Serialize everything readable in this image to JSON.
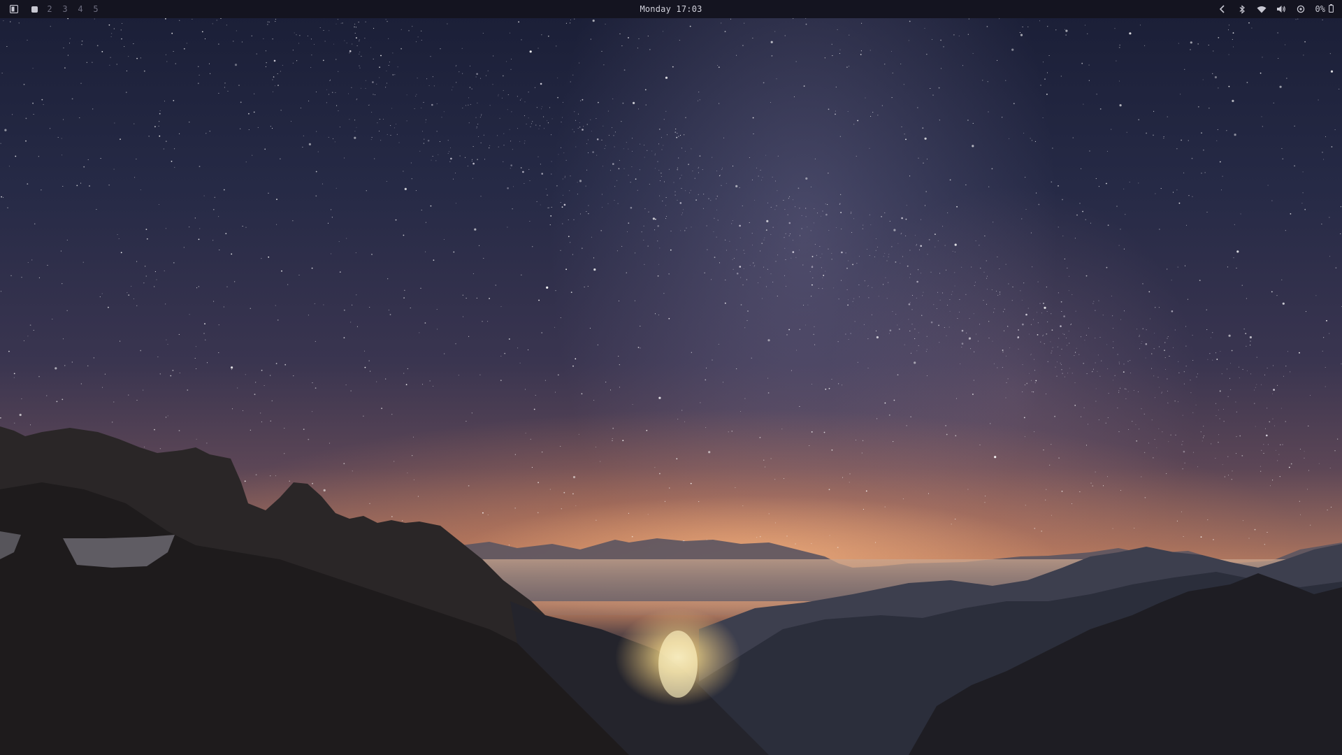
{
  "topbar": {
    "launcher_icon": "layout-icon",
    "workspaces": [
      {
        "label": "",
        "active": true
      },
      {
        "label": "2",
        "active": false
      },
      {
        "label": "3",
        "active": false
      },
      {
        "label": "4",
        "active": false
      },
      {
        "label": "5",
        "active": false
      }
    ],
    "clock": "Monday 17:03",
    "tray": {
      "expand_icon": "chevron-left-icon",
      "bluetooth_icon": "bluetooth-icon",
      "wifi_icon": "wifi-icon",
      "volume_icon": "volume-icon",
      "settings_icon": "power-settings-icon",
      "battery_percent": "0%",
      "battery_icon": "battery-icon"
    }
  },
  "colors": {
    "bar_background": "#141420",
    "bar_text": "#c8c8d2",
    "bar_inactive": "#6e6e80"
  }
}
